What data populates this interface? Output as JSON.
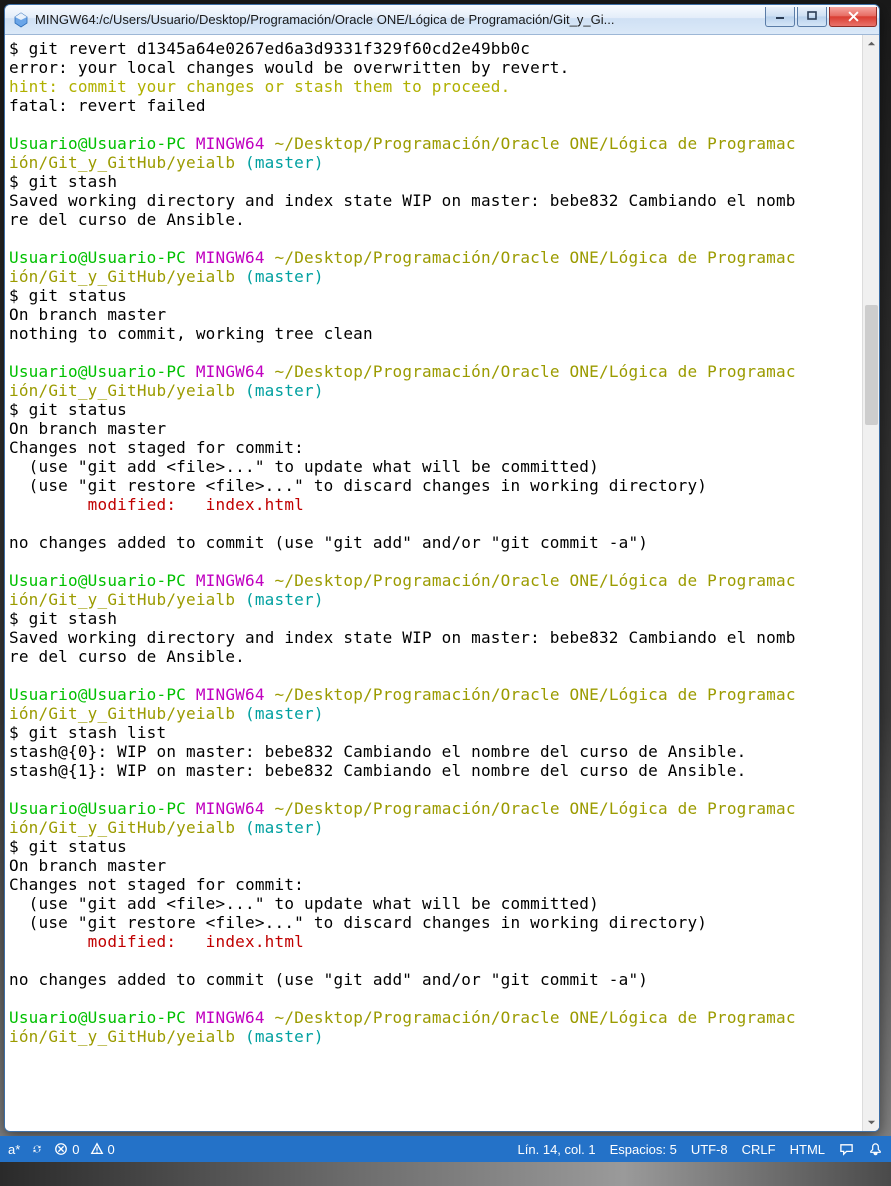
{
  "window": {
    "title": "MINGW64:/c/Users/Usuario/Desktop/Programación/Oracle ONE/Lógica de Programación/Git_y_Gi..."
  },
  "prompt": {
    "user_host": "Usuario@Usuario-PC",
    "env": "MINGW64",
    "path1": "~/Desktop/Programación/Oracle ONE/Lógica de Programac",
    "path2": "ión/Git_y_GitHub/yeialb",
    "branch": "(master)"
  },
  "term": {
    "l1": "$ git revert d1345a64e0267ed6a3d9331f329f60cd2e49bb0c",
    "l2": "error: your local changes would be overwritten by revert.",
    "l3": "hint: commit your changes or stash them to proceed.",
    "l4": "fatal: revert failed",
    "cmd_stash": "$ git stash",
    "stash_saved1": "Saved working directory and index state WIP on master: bebe832 Cambiando el nomb",
    "stash_saved2": "re del curso de Ansible.",
    "cmd_status": "$ git status",
    "on_branch": "On branch master",
    "nothing_commit": "nothing to commit, working tree clean",
    "changes_not_staged": "Changes not staged for commit:",
    "use_add": "  (use \"git add <file>...\" to update what will be committed)",
    "use_restore": "  (use \"git restore <file>...\" to discard changes in working directory)",
    "modified": "        modified:   index.html",
    "no_changes": "no changes added to commit (use \"git add\" and/or \"git commit -a\")",
    "cmd_stash_list": "$ git stash list",
    "stash0": "stash@{0}: WIP on master: bebe832 Cambiando el nombre del curso de Ansible.",
    "stash1": "stash@{1}: WIP on master: bebe832 Cambiando el nombre del curso de Ansible."
  },
  "statusbar": {
    "branch_indicator": "a*",
    "sync": "⊘ 0 ⚠ 0",
    "errors": "0",
    "warnings": "0",
    "line_col": "Lín. 14, col. 1",
    "spaces": "Espacios: 5",
    "encoding": "UTF-8",
    "eol": "CRLF",
    "lang": "HTML"
  }
}
